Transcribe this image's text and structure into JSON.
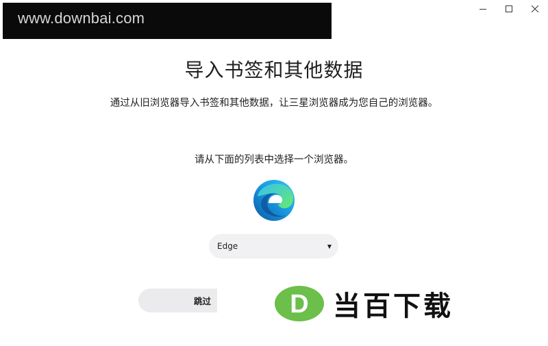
{
  "watermark": {
    "url_text": "www.downbai.com",
    "logo_text": "当百下载",
    "logo_letter": "D"
  },
  "page": {
    "title": "导入书签和其他数据",
    "subtitle": "通过从旧浏览器导入书签和其他数据，让三星浏览器成为您自己的浏览器。",
    "choose_label": "请从下面的列表中选择一个浏览器。"
  },
  "browser_select": {
    "selected_value": "Edge"
  },
  "buttons": {
    "skip_label": "跳过"
  },
  "colors": {
    "edge_blue": "#1565c0",
    "edge_green": "#4fd06a",
    "logo_green": "#6bbf4a"
  }
}
